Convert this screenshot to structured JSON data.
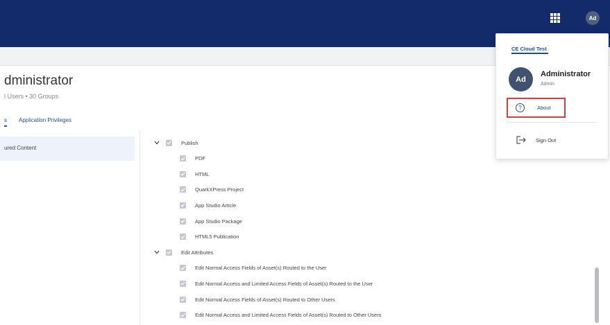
{
  "header": {
    "apps_icon": "grid-icon",
    "avatar_initials": "Ad"
  },
  "page": {
    "title": "dministrator",
    "subtitle": "l Users  •  30 Groups"
  },
  "tabs": [
    {
      "label": "s"
    },
    {
      "label": "Application Privileges"
    }
  ],
  "left_panel": {
    "items": [
      {
        "label": "ured Content"
      }
    ]
  },
  "tree": [
    {
      "label": "Publish",
      "level": 0,
      "expanded": true,
      "checked": true
    },
    {
      "label": "PDF",
      "level": 1,
      "checked": true
    },
    {
      "label": "HTML",
      "level": 1,
      "checked": true
    },
    {
      "label": "QuarkXPress Project",
      "level": 1,
      "checked": true
    },
    {
      "label": "App Studio Article",
      "level": 1,
      "checked": true
    },
    {
      "label": "App Studio Package",
      "level": 1,
      "checked": true
    },
    {
      "label": "HTML5 Publication",
      "level": 1,
      "checked": true
    },
    {
      "label": "Edit Attributes",
      "level": 0,
      "expanded": true,
      "checked": true
    },
    {
      "label": "Edit Normal Access Fields of Asset(s) Routed to the User",
      "level": 1,
      "checked": true
    },
    {
      "label": "Edit Normal Access and Limited Access Fields of Asset(s) Routed to the User",
      "level": 1,
      "checked": true
    },
    {
      "label": "Edit Normal Access Fields of Asset(s) Routed to Other Users",
      "level": 1,
      "checked": true
    },
    {
      "label": "Edit Normal Access and Limited Access Fields of Asset(s) Routed to Other Users",
      "level": 1,
      "checked": true
    }
  ],
  "user_menu": {
    "org_name": "CE Cloud Test",
    "avatar_initials": "Ad",
    "user_name": "Administrator",
    "user_role": "Admin",
    "about_label": "About",
    "about_icon_glyph": "?",
    "signout_label": "Sign Out"
  },
  "colors": {
    "header_bg": "#132a6b",
    "accent": "#1a4fa3",
    "highlight_border": "#e03b3b"
  }
}
